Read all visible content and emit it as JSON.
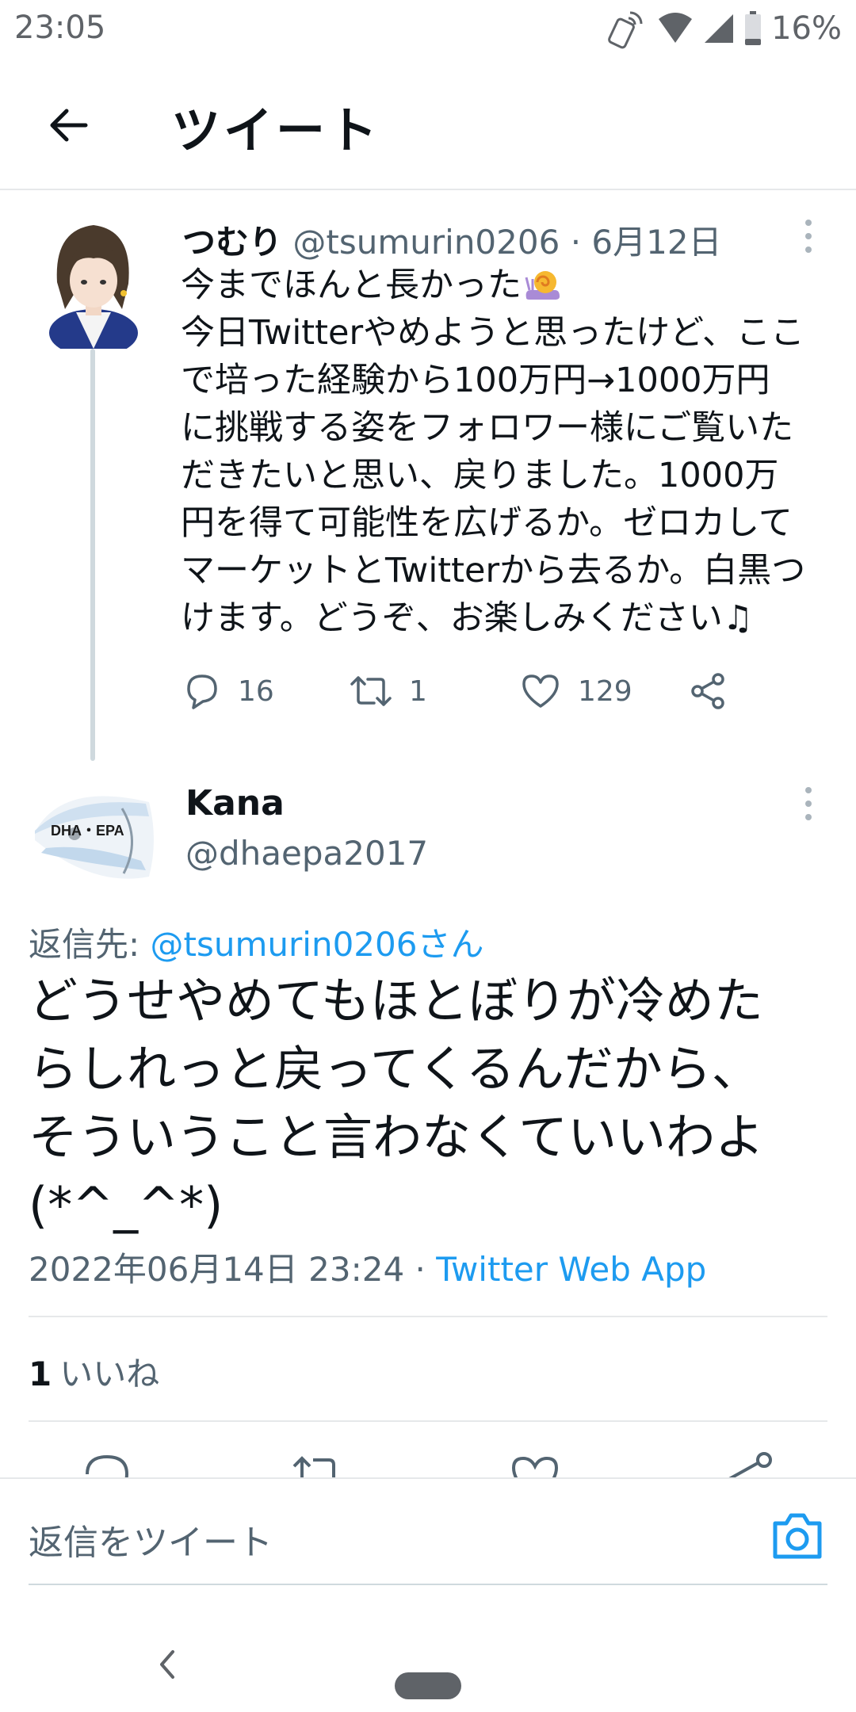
{
  "status_bar": {
    "time": "23:05",
    "battery_text": "16%",
    "icons": [
      "vibrate-icon",
      "wifi-icon",
      "signal-icon",
      "battery-icon"
    ]
  },
  "header": {
    "title": "ツイート",
    "back_icon": "arrow-left-icon"
  },
  "original_tweet": {
    "name": "つむり",
    "handle": "@tsumurin0206",
    "separator": "·",
    "date": "6月12日",
    "text_lines": [
      "今までほんと長かった",
      "今日Twitterやめようと思ったけど、ここ",
      "で培った経験から100万円→1000万円",
      "に挑戦する姿をフォロワー様にご覧いた",
      "だきたいと思い、戻りました。1000万",
      "円を得て可能性を広げるか。ゼロカして",
      "マーケットとTwitterから去るか。白黒つ",
      "けます。どうぞ、お楽しみください♫"
    ],
    "emoji": "snail-emoji",
    "replies": "16",
    "retweets": "1",
    "likes": "129"
  },
  "reply_tweet": {
    "name": "Kana",
    "handle": "@dhaepa2017",
    "avatar_text": "DHA・EPA",
    "replying_to_label": "返信先:",
    "replying_to_user": "@tsumurin0206さん",
    "text_lines": [
      "どうせやめてもほとぼりが冷めた",
      "らしれっと戻ってくるんだから、",
      "そういうこと言わなくていいわよ",
      "(*^_^*)"
    ],
    "timestamp": "2022年06月14日 23:24",
    "timestamp_separator": "·",
    "source": "Twitter Web App",
    "like_count": "1",
    "like_label": "いいね"
  },
  "compose": {
    "placeholder": "返信をツイート",
    "camera_icon": "camera-icon"
  },
  "colors": {
    "accent": "#1d9bf0",
    "text": "#0f1419",
    "secondary_text": "#536471",
    "divider": "#e6e8ea"
  }
}
